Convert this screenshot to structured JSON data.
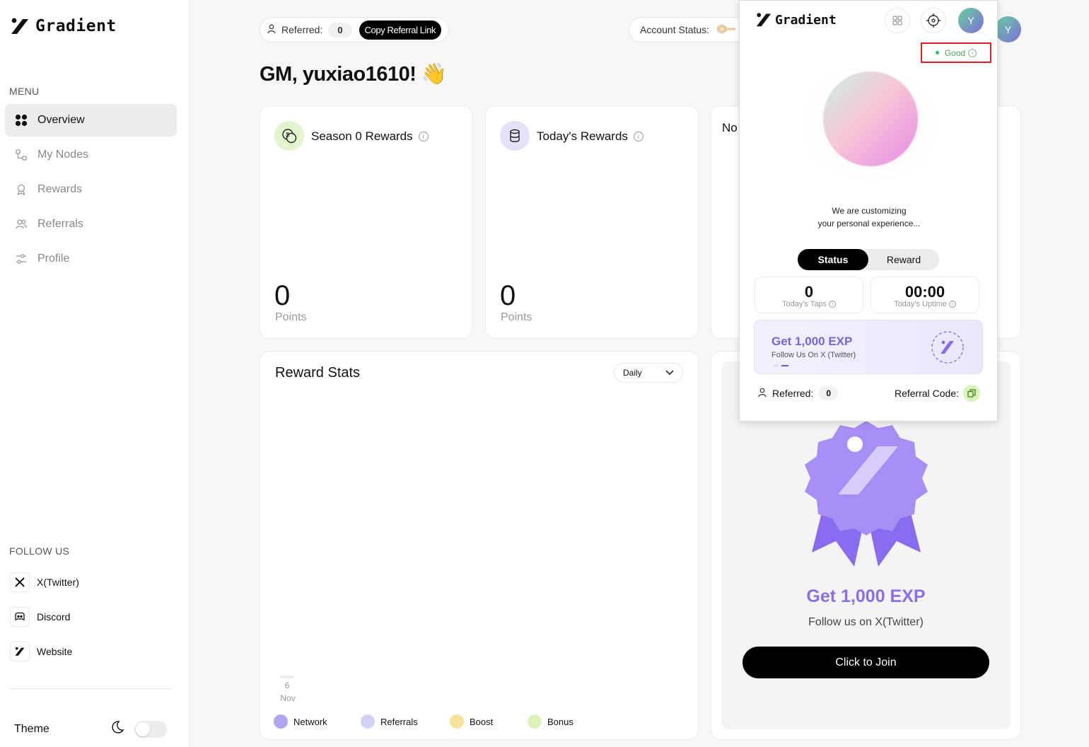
{
  "brand": {
    "name": "Gradient"
  },
  "sidebar": {
    "menu_label": "MENU",
    "items": [
      {
        "label": "Overview",
        "icon": "grid-icon",
        "active": true
      },
      {
        "label": "My Nodes",
        "icon": "nodes-icon"
      },
      {
        "label": "Rewards",
        "icon": "award-icon"
      },
      {
        "label": "Referrals",
        "icon": "users-icon"
      },
      {
        "label": "Profile",
        "icon": "sliders-icon"
      }
    ],
    "follow_label": "FOLLOW US",
    "follow": [
      {
        "label": "X(Twitter)",
        "icon": "x-icon"
      },
      {
        "label": "Discord",
        "icon": "discord-icon"
      },
      {
        "label": "Website",
        "icon": "gradient-logo-icon"
      }
    ],
    "theme_label": "Theme"
  },
  "topbar": {
    "referred_label": "Referred:",
    "referred_count": "0",
    "copy_label": "Copy Referral Link",
    "account_status_label": "Account Status:",
    "avatar_letter": "Y"
  },
  "greeting": "GM, yuxiao1610! 👋",
  "cards": {
    "season": {
      "title": "Season 0 Rewards",
      "value": "0",
      "unit": "Points"
    },
    "today": {
      "title": "Today's Rewards",
      "value": "0",
      "unit": "Points"
    },
    "node_partial": "No"
  },
  "stats": {
    "title": "Reward Stats",
    "period": "Daily",
    "xtick_day": "6",
    "xtick_month": "Nov",
    "legend": [
      {
        "name": "Network",
        "color": "#b3a4f0"
      },
      {
        "name": "Referrals",
        "color": "#d3d2f6"
      },
      {
        "name": "Boost",
        "color": "#f6e39a"
      },
      {
        "name": "Bonus",
        "color": "#dcf2b8"
      }
    ]
  },
  "join": {
    "title": "Get 1,000 EXP",
    "subtitle": "Follow us on X(Twitter)",
    "button": "Click to Join"
  },
  "popup": {
    "brand": "Gradient",
    "avatar_letter": "Y",
    "status": "Good",
    "custom_line1": "We are customizing",
    "custom_line2": "your personal experience...",
    "tabs": [
      "Status",
      "Reward"
    ],
    "taps_value": "0",
    "taps_label": "Today's Taps",
    "uptime_value": "00:00",
    "uptime_label": "Today's Uptime",
    "exp_title": "Get 1,000 EXP",
    "exp_sub": "Follow Us On X (Twitter)",
    "referred_label": "Referred:",
    "referred_count": "0",
    "code_label": "Referral Code:"
  }
}
